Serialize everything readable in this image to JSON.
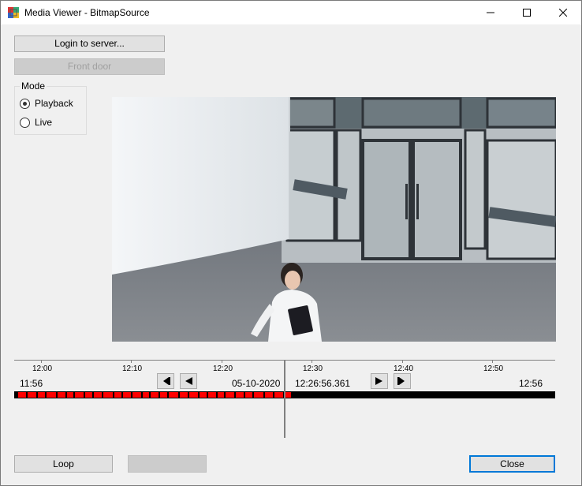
{
  "window": {
    "title": "Media Viewer - BitmapSource"
  },
  "buttons": {
    "login": "Login to server...",
    "camera": "Front door",
    "loop": "Loop",
    "blank": "",
    "close": "Close"
  },
  "mode": {
    "label": "Mode",
    "options": [
      {
        "label": "Playback",
        "checked": true
      },
      {
        "label": "Live",
        "checked": false
      }
    ]
  },
  "timeline": {
    "ticks": [
      "12:00",
      "12:10",
      "12:20",
      "12:30",
      "12:40",
      "12:50"
    ],
    "start_time": "11:56",
    "end_time": "12:56",
    "date": "05-10-2020",
    "current_time": "12:26:56.361",
    "recording_color": "#ff0000",
    "empty_color": "#000000"
  },
  "colors": {
    "accent": "#0078d7"
  }
}
